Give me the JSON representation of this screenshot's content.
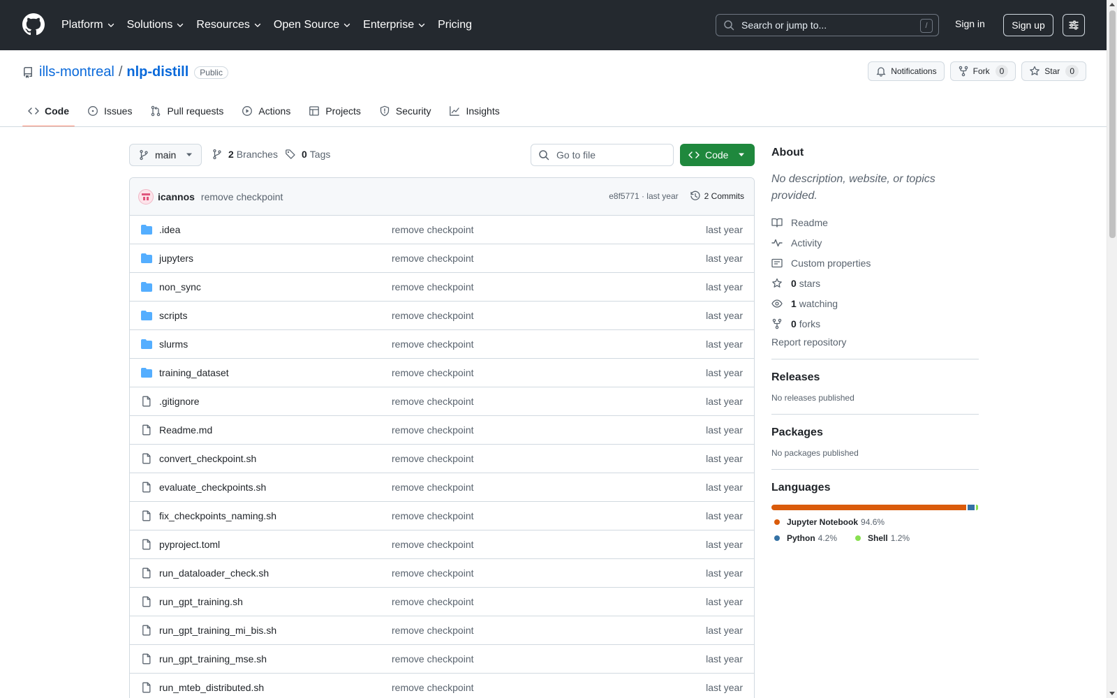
{
  "header": {
    "nav": [
      {
        "label": "Platform",
        "dropdown": true
      },
      {
        "label": "Solutions",
        "dropdown": true
      },
      {
        "label": "Resources",
        "dropdown": true
      },
      {
        "label": "Open Source",
        "dropdown": true
      },
      {
        "label": "Enterprise",
        "dropdown": true
      },
      {
        "label": "Pricing",
        "dropdown": false
      }
    ],
    "search_placeholder": "Search or jump to...",
    "search_shortcut": "/",
    "sign_in": "Sign in",
    "sign_up": "Sign up",
    "icons": {
      "logo": "github-mark-icon",
      "search": "search-icon",
      "menu": "sliders-icon"
    }
  },
  "repo": {
    "owner": "ills-montreal",
    "separator": "/",
    "name": "nlp-distill",
    "visibility": "Public",
    "notifications_label": "Notifications",
    "fork_label": "Fork",
    "fork_count": "0",
    "star_label": "Star",
    "star_count": "0"
  },
  "tabs": [
    {
      "label": "Code",
      "icon": "code-icon",
      "active": true
    },
    {
      "label": "Issues",
      "icon": "issue-opened-icon",
      "active": false
    },
    {
      "label": "Pull requests",
      "icon": "git-pull-request-icon",
      "active": false
    },
    {
      "label": "Actions",
      "icon": "play-icon",
      "active": false
    },
    {
      "label": "Projects",
      "icon": "table-icon",
      "active": false
    },
    {
      "label": "Security",
      "icon": "shield-icon",
      "active": false
    },
    {
      "label": "Insights",
      "icon": "graph-icon",
      "active": false
    }
  ],
  "toolbar": {
    "branch": "main",
    "branches_count": "2",
    "branches_label": "Branches",
    "tags_count": "0",
    "tags_label": "Tags",
    "goto_placeholder": "Go to file",
    "code_label": "Code"
  },
  "commit": {
    "author": "icannos",
    "message": "remove checkpoint",
    "hash": "e8f5771",
    "separator": " · ",
    "date": "last year",
    "commits_label": "2 Commits"
  },
  "files": [
    {
      "name": ".idea",
      "type": "dir",
      "message": "remove checkpoint",
      "date": "last year"
    },
    {
      "name": "jupyters",
      "type": "dir",
      "message": "remove checkpoint",
      "date": "last year"
    },
    {
      "name": "non_sync",
      "type": "dir",
      "message": "remove checkpoint",
      "date": "last year"
    },
    {
      "name": "scripts",
      "type": "dir",
      "message": "remove checkpoint",
      "date": "last year"
    },
    {
      "name": "slurms",
      "type": "dir",
      "message": "remove checkpoint",
      "date": "last year"
    },
    {
      "name": "training_dataset",
      "type": "dir",
      "message": "remove checkpoint",
      "date": "last year"
    },
    {
      "name": ".gitignore",
      "type": "file",
      "message": "remove checkpoint",
      "date": "last year"
    },
    {
      "name": "Readme.md",
      "type": "file",
      "message": "remove checkpoint",
      "date": "last year"
    },
    {
      "name": "convert_checkpoint.sh",
      "type": "file",
      "message": "remove checkpoint",
      "date": "last year"
    },
    {
      "name": "evaluate_checkpoints.sh",
      "type": "file",
      "message": "remove checkpoint",
      "date": "last year"
    },
    {
      "name": "fix_checkpoints_naming.sh",
      "type": "file",
      "message": "remove checkpoint",
      "date": "last year"
    },
    {
      "name": "pyproject.toml",
      "type": "file",
      "message": "remove checkpoint",
      "date": "last year"
    },
    {
      "name": "run_dataloader_check.sh",
      "type": "file",
      "message": "remove checkpoint",
      "date": "last year"
    },
    {
      "name": "run_gpt_training.sh",
      "type": "file",
      "message": "remove checkpoint",
      "date": "last year"
    },
    {
      "name": "run_gpt_training_mi_bis.sh",
      "type": "file",
      "message": "remove checkpoint",
      "date": "last year"
    },
    {
      "name": "run_gpt_training_mse.sh",
      "type": "file",
      "message": "remove checkpoint",
      "date": "last year"
    },
    {
      "name": "run_mteb_distributed.sh",
      "type": "file",
      "message": "remove checkpoint",
      "date": "last year"
    }
  ],
  "sidebar": {
    "about_title": "About",
    "about_desc": "No description, website, or topics provided.",
    "items": [
      {
        "icon": "book-icon",
        "count": "",
        "label": "Readme"
      },
      {
        "icon": "pulse-icon",
        "count": "",
        "label": "Activity"
      },
      {
        "icon": "note-icon",
        "count": "",
        "label": "Custom properties"
      },
      {
        "icon": "star-icon",
        "count": "0",
        "label": "stars"
      },
      {
        "icon": "eye-icon",
        "count": "1",
        "label": "watching"
      },
      {
        "icon": "repo-forked-icon",
        "count": "0",
        "label": "forks"
      }
    ],
    "report": "Report repository",
    "releases_title": "Releases",
    "releases_empty": "No releases published",
    "packages_title": "Packages",
    "packages_empty": "No packages published",
    "languages_title": "Languages",
    "languages": [
      {
        "name": "Jupyter Notebook",
        "percent": "94.6%",
        "value": 94.6,
        "color": "#DA5B0B"
      },
      {
        "name": "Python",
        "percent": "4.2%",
        "value": 4.2,
        "color": "#3572A5"
      },
      {
        "name": "Shell",
        "percent": "1.2%",
        "value": 1.2,
        "color": "#89e051"
      }
    ]
  }
}
